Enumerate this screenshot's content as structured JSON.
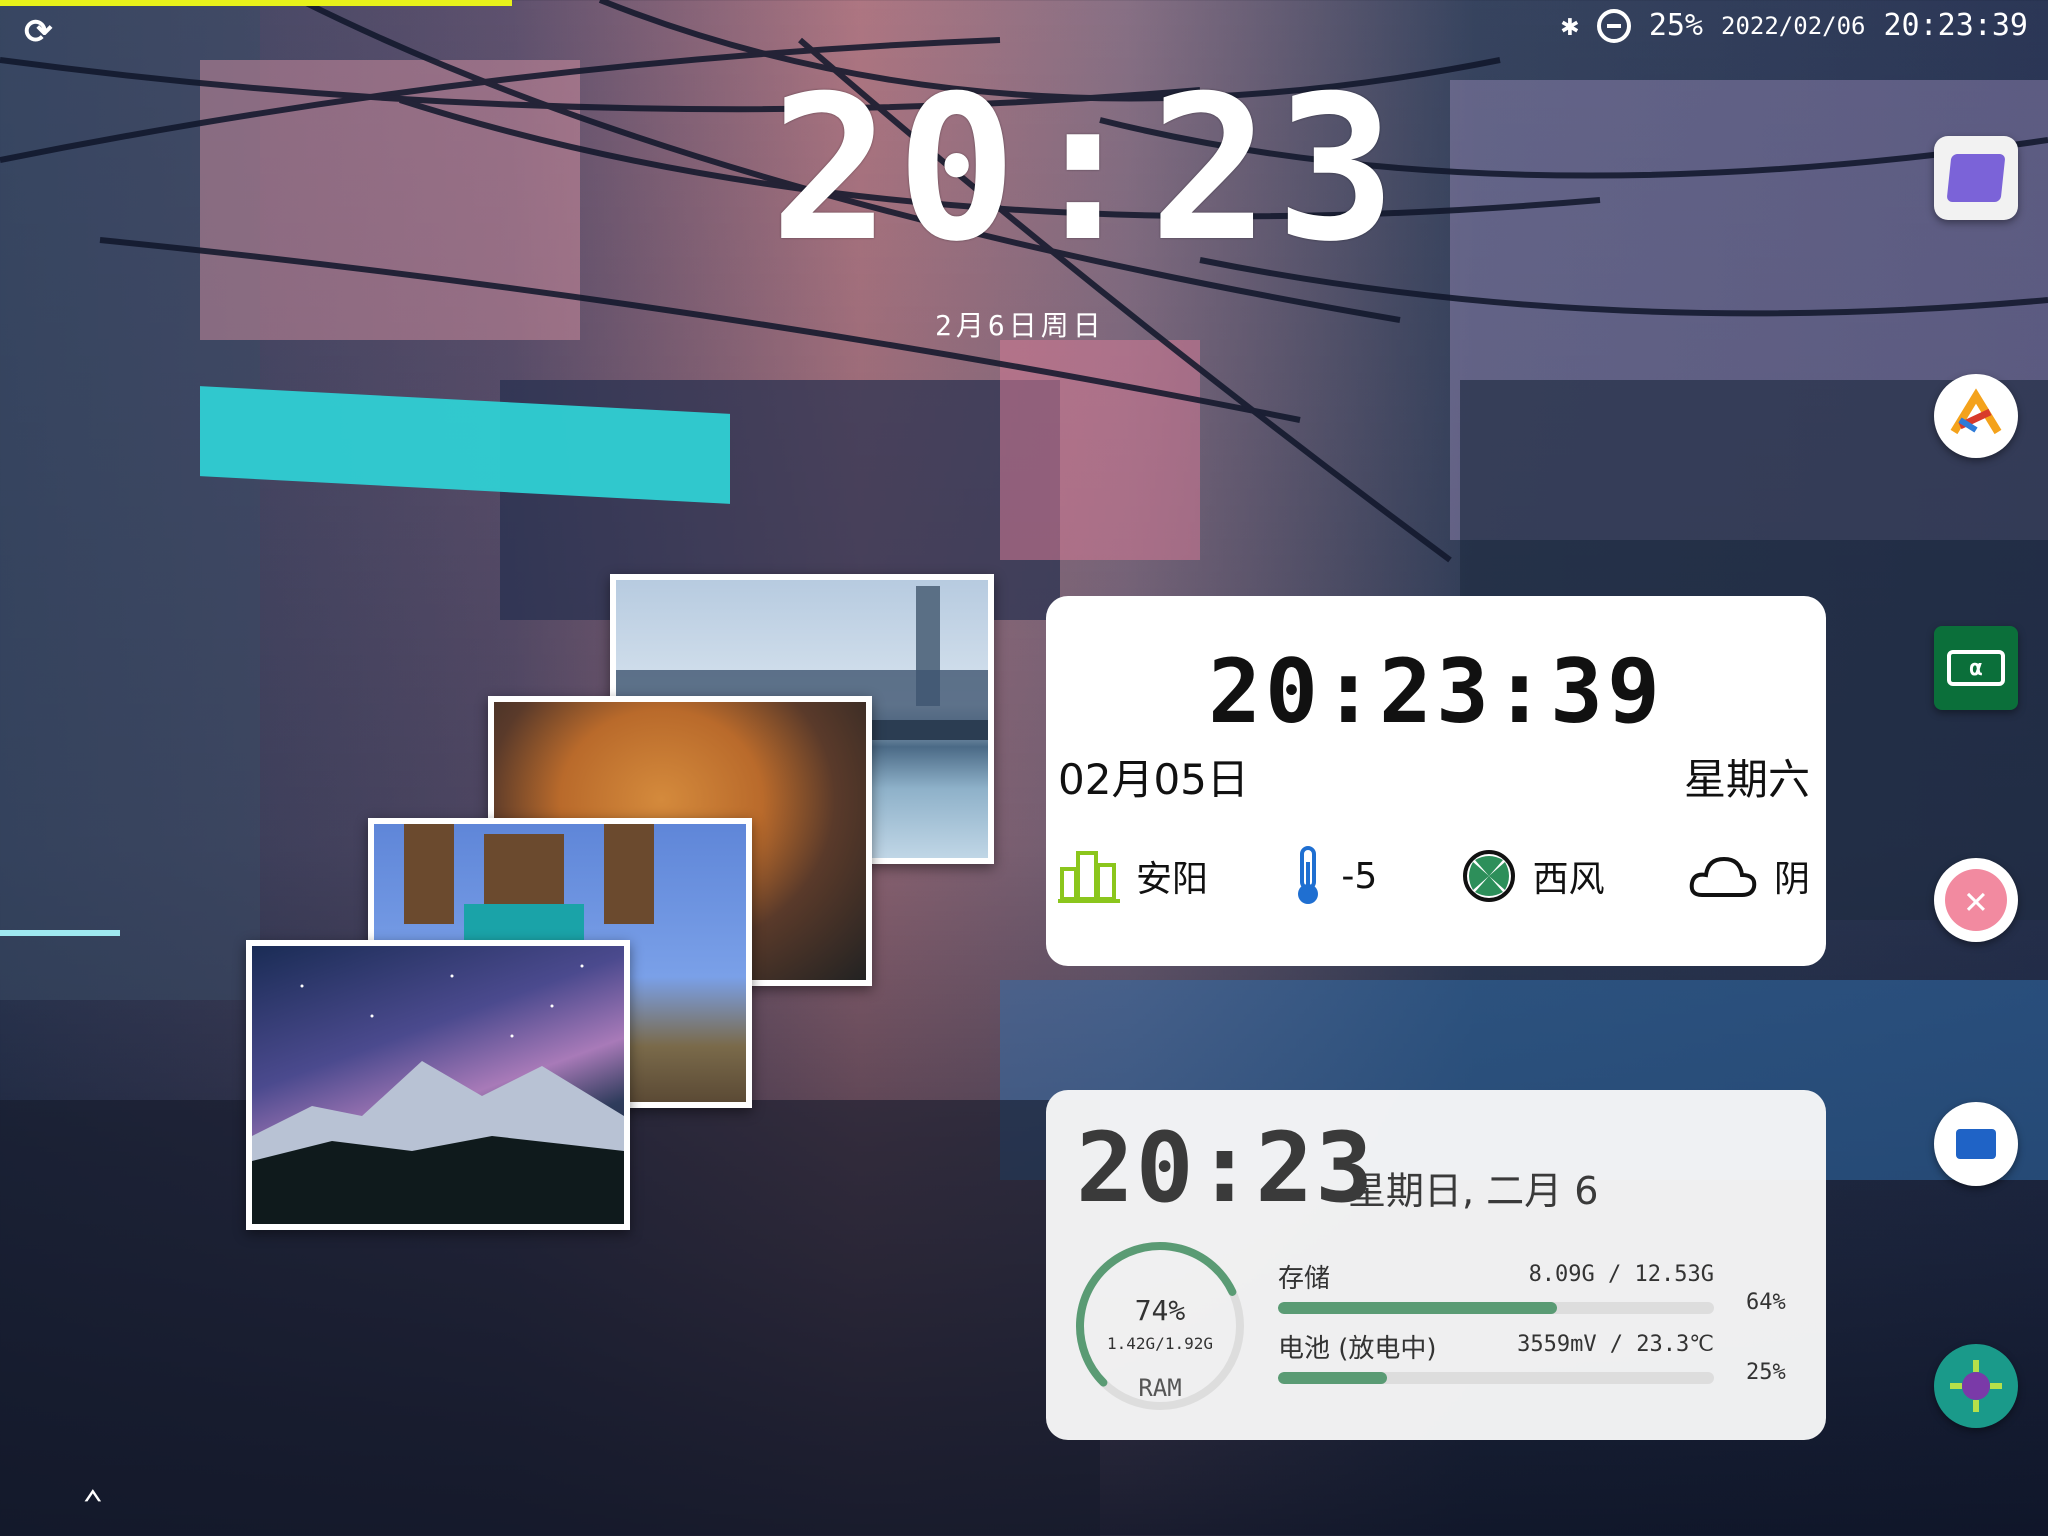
{
  "status_bar": {
    "battery": "25%",
    "date": "2022/02/06",
    "time": "20:23:39",
    "icons": [
      "sync-icon",
      "bluetooth-icon",
      "do-not-disturb-icon"
    ]
  },
  "lock_clock": {
    "time": "20:23",
    "date": "2月6日周日"
  },
  "photo_stack": {
    "photos": [
      "city-skyline",
      "dog",
      "minecraft-steve",
      "night-mountains"
    ]
  },
  "weather_widget": {
    "time": "20:23:39",
    "date": "02月05日",
    "weekday": "星期六",
    "city": "安阳",
    "temperature": "-5",
    "wind": "西风",
    "condition": "阴",
    "icons": [
      "city-icon",
      "thermometer-icon",
      "wind-icon",
      "cloud-icon"
    ]
  },
  "system_widget": {
    "time": "20:23",
    "date": "星期日, 二月 6",
    "ram": {
      "percent_text": "74%",
      "detail": "1.42G/1.92G",
      "label": "RAM",
      "fraction": 0.74
    },
    "storage": {
      "label": "存储",
      "value": "8.09G / 12.53G",
      "percent_text": "64%",
      "fraction": 0.64
    },
    "battery": {
      "label": "电池 (放电中)",
      "value": "3559mV / 23.3℃",
      "percent_text": "25%",
      "fraction": 0.25
    },
    "accent_color": "#5a9b74"
  },
  "dock": {
    "apps": [
      "purple-folder-app-icon",
      "artstudio-app-icon",
      "green-screen-app-icon",
      "pink-bandage-app-icon",
      "files-app-icon",
      "green-gear-app-icon"
    ]
  },
  "colors": {
    "progress_strip": "#e8f21a",
    "weather_city_icon": "#8bc61c",
    "weather_thermo_icon": "#1f6fd1",
    "weather_wind_icon": "#2d8f5a"
  }
}
